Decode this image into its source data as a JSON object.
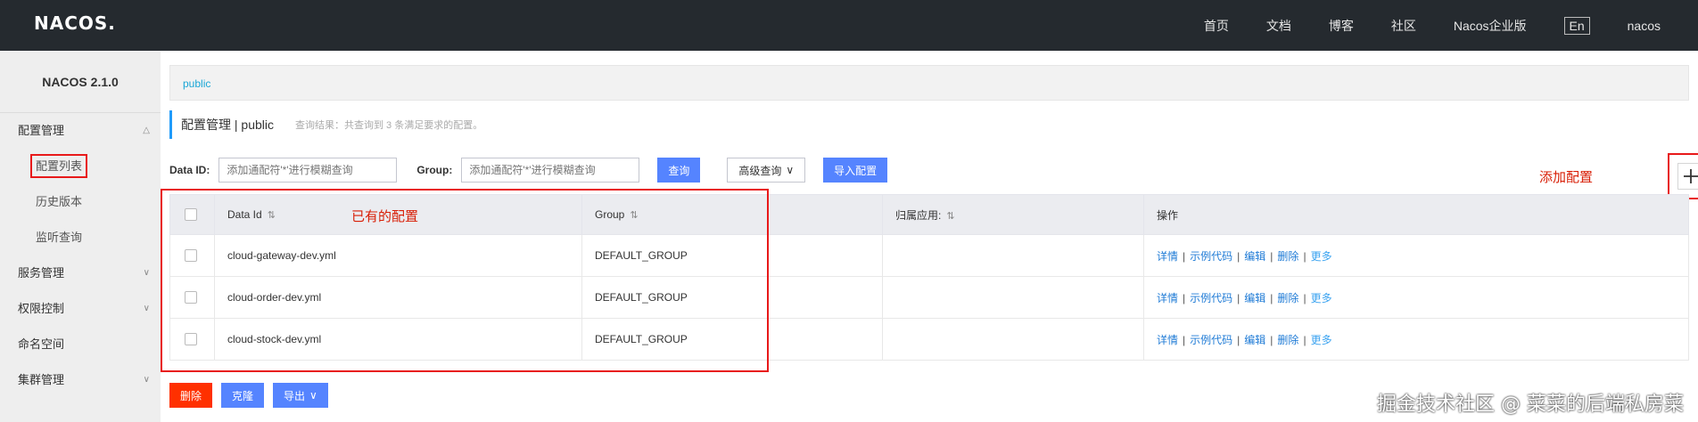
{
  "header": {
    "logo": "NACOS.",
    "nav": [
      "首页",
      "文档",
      "博客",
      "社区",
      "Nacos企业版"
    ],
    "lang": "En",
    "user": "nacos"
  },
  "sidebar": {
    "version": "NACOS 2.1.0",
    "items": [
      {
        "label": "配置管理",
        "sub": false,
        "chevron": "up"
      },
      {
        "label": "配置列表",
        "sub": true,
        "active": true
      },
      {
        "label": "历史版本",
        "sub": true
      },
      {
        "label": "监听查询",
        "sub": true
      },
      {
        "label": "服务管理",
        "sub": false,
        "chevron": "down"
      },
      {
        "label": "权限控制",
        "sub": false,
        "chevron": "down"
      },
      {
        "label": "命名空间",
        "sub": false
      },
      {
        "label": "集群管理",
        "sub": false,
        "chevron": "down"
      }
    ]
  },
  "breadcrumb": "public",
  "title": {
    "main": "配置管理 | public",
    "hint": "查询结果：共查询到 3 条满足要求的配置。"
  },
  "search": {
    "dataid_label": "Data ID:",
    "dataid_placeholder": "添加通配符'*'进行模糊查询",
    "group_label": "Group:",
    "group_placeholder": "添加通配符'*'进行模糊查询",
    "query_btn": "查询",
    "advanced_btn": "高级查询",
    "import_btn": "导入配置"
  },
  "annotations": {
    "add_config": "添加配置",
    "existing": "已有的配置"
  },
  "table": {
    "headers": [
      "Data Id",
      "Group",
      "归属应用:",
      "操作"
    ],
    "rows": [
      {
        "dataid": "cloud-gateway-dev.yml",
        "group": "DEFAULT_GROUP",
        "app": ""
      },
      {
        "dataid": "cloud-order-dev.yml",
        "group": "DEFAULT_GROUP",
        "app": ""
      },
      {
        "dataid": "cloud-stock-dev.yml",
        "group": "DEFAULT_GROUP",
        "app": ""
      }
    ],
    "ops": {
      "detail": "详情",
      "sample": "示例代码",
      "edit": "编辑",
      "delete": "删除",
      "more": "更多"
    }
  },
  "bottom": {
    "delete_btn": "删除",
    "clone_btn": "克隆",
    "export_btn": "导出"
  },
  "watermark": "掘金技术社区 @ 菜菜的后端私房菜",
  "colors": {
    "header_bg": "#252a2f",
    "primary": "#5584ff",
    "danger": "#ff3000",
    "annotation": "#d81e06"
  }
}
